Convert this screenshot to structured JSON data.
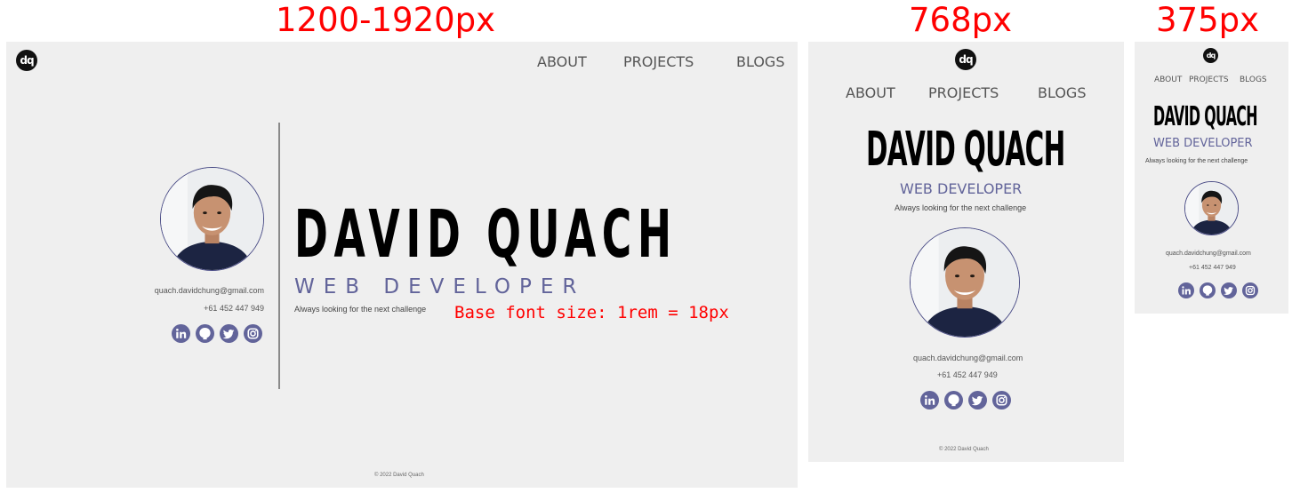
{
  "breakpoints": {
    "desktop": "1200-1920px",
    "tablet": "768px",
    "mobile": "375px"
  },
  "logo_text": "dq",
  "nav": {
    "about": "ABOUT",
    "projects": "PROJECTS",
    "blogs": "BLOGS"
  },
  "hero": {
    "name": "DAVID QUACH",
    "role": "WEB DEVELOPER",
    "tagline": "Always looking for the next challenge"
  },
  "contact": {
    "email": "quach.davidchung@gmail.com",
    "phone": "+61 452 447 949"
  },
  "socials": [
    "linkedin-icon",
    "github-icon",
    "twitter-icon",
    "instagram-icon"
  ],
  "footer": "© 2022 David Quach",
  "annotation": "Base font size: 1rem = 18px",
  "colors": {
    "accent": "#62649a",
    "background": "#efefef",
    "breakpoint_label": "#ff0000"
  }
}
